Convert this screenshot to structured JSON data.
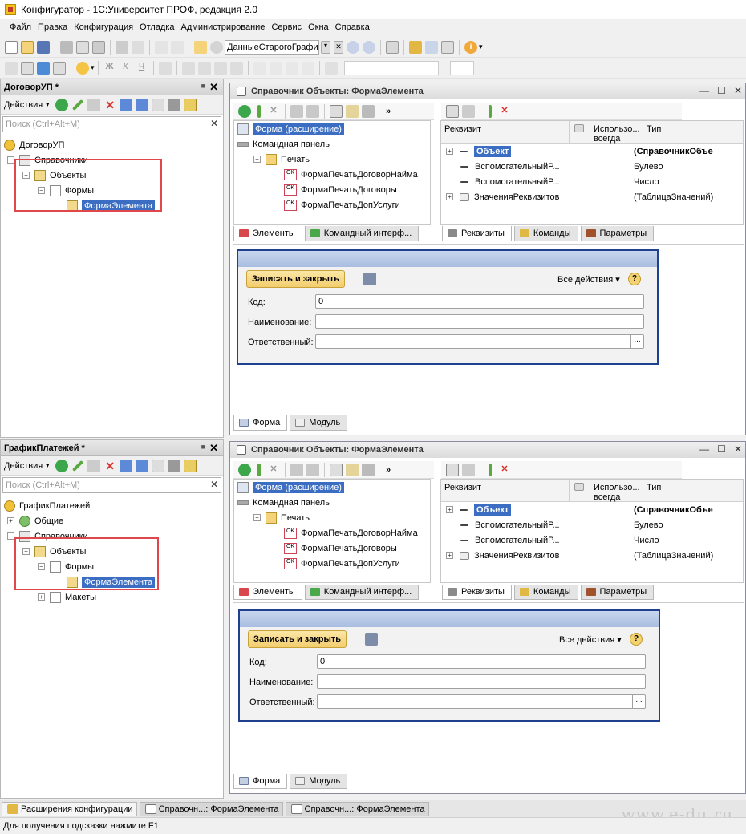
{
  "window": {
    "title": "Конфигуратор - 1С:Университет ПРОФ, редакция 2.0"
  },
  "menu": [
    "Файл",
    "Правка",
    "Конфигурация",
    "Отладка",
    "Администрирование",
    "Сервис",
    "Окна",
    "Справка"
  ],
  "toolbar": {
    "combo_value": "ДанныеСтарогоГрафи"
  },
  "left_panels": [
    {
      "title": "ДоговорУП *",
      "actions_label": "Действия",
      "search_placeholder": "Поиск (Ctrl+Alt+M)",
      "tree": [
        {
          "label": "ДоговорУП",
          "level": 0
        },
        {
          "label": "Справочники",
          "level": 0
        },
        {
          "label": "Объекты",
          "level": 1
        },
        {
          "label": "Формы",
          "level": 2
        },
        {
          "label": "ФормаЭлемента",
          "level": 3,
          "selected": true
        }
      ]
    },
    {
      "title": "ГрафикПлатежей *",
      "actions_label": "Действия",
      "search_placeholder": "Поиск (Ctrl+Alt+M)",
      "tree": [
        {
          "label": "ГрафикПлатежей",
          "level": 0
        },
        {
          "label": "Общие",
          "level": 0
        },
        {
          "label": "Справочники",
          "level": 0
        },
        {
          "label": "Объекты",
          "level": 1
        },
        {
          "label": "Формы",
          "level": 2
        },
        {
          "label": "ФормаЭлемента",
          "level": 3,
          "selected": true
        },
        {
          "label": "Макеты",
          "level": 2
        }
      ]
    }
  ],
  "editors": [
    {
      "title": "Справочник Объекты: ФормаЭлемента",
      "elements": [
        "Форма (расширение)",
        "Командная панель",
        "Печать",
        "ФормаПечатьДоговорНайма",
        "ФормаПечатьДоговоры",
        "ФормаПечатьДопУслуги"
      ],
      "attr_headers": {
        "rekvizit": "Реквизит",
        "use": "Использо... всегда",
        "type": "Тип"
      },
      "attrs": [
        {
          "name": "Объект",
          "type": "(СправочникОбъе"
        },
        {
          "name": "ВспомогательныйР...",
          "type": "Булево"
        },
        {
          "name": "ВспомогательныйР...",
          "type": "Число"
        },
        {
          "name": "ЗначенияРеквизитов",
          "type": "(ТаблицаЗначений)"
        }
      ],
      "left_tabs": [
        "Элементы",
        "Командный интерф..."
      ],
      "right_tabs": [
        "Реквизиты",
        "Команды",
        "Параметры"
      ],
      "form": {
        "save_close": "Записать и закрыть",
        "all_actions": "Все действия ▾",
        "help": "?",
        "fields": [
          {
            "label": "Код:",
            "value": "0"
          },
          {
            "label": "Наименование:",
            "value": ""
          },
          {
            "label": "Ответственный:",
            "value": ""
          }
        ]
      },
      "bottom_tabs": [
        "Форма",
        "Модуль"
      ]
    },
    {
      "title": "Справочник Объекты: ФормаЭлемента",
      "elements": [
        "Форма (расширение)",
        "Командная панель",
        "Печать",
        "ФормаПечатьДоговорНайма",
        "ФормаПечатьДоговоры",
        "ФормаПечатьДопУслуги"
      ],
      "attr_headers": {
        "rekvizit": "Реквизит",
        "use": "Использо... всегда",
        "type": "Тип"
      },
      "attrs": [
        {
          "name": "Объект",
          "type": "(СправочникОбъе"
        },
        {
          "name": "ВспомогательныйР...",
          "type": "Булево"
        },
        {
          "name": "ВспомогательныйР...",
          "type": "Число"
        },
        {
          "name": "ЗначенияРеквизитов",
          "type": "(ТаблицаЗначений)"
        }
      ],
      "left_tabs": [
        "Элементы",
        "Командный интерф..."
      ],
      "right_tabs": [
        "Реквизиты",
        "Команды",
        "Параметры"
      ],
      "form": {
        "save_close": "Записать и закрыть",
        "all_actions": "Все действия ▾",
        "help": "?",
        "fields": [
          {
            "label": "Код:",
            "value": "0"
          },
          {
            "label": "Наименование:",
            "value": ""
          },
          {
            "label": "Ответственный:",
            "value": ""
          }
        ]
      },
      "bottom_tabs": [
        "Форма",
        "Модуль"
      ]
    }
  ],
  "taskbar": [
    "Расширения конфигурации",
    "Справочн...: ФормаЭлемента",
    "Справочн...: ФормаЭлемента"
  ],
  "status": "Для получения подсказки нажмите F1",
  "watermark": "www.e-du.ru",
  "colors": {
    "selection": "#3b6dc2",
    "highlight_box": "#e0474c",
    "save_button": "#f2cd6d"
  }
}
